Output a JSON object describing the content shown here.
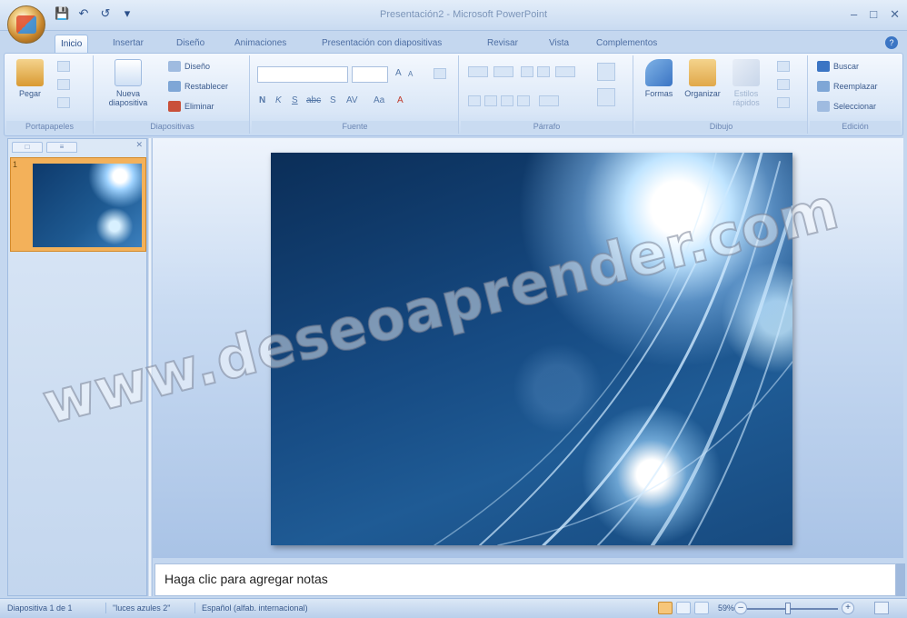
{
  "window": {
    "title": "Presentación2 - Microsoft PowerPoint"
  },
  "tabs": [
    "Inicio",
    "Insertar",
    "Diseño",
    "Animaciones",
    "Presentación con diapositivas",
    "Revisar",
    "Vista",
    "Complementos"
  ],
  "ribbon": {
    "portapapeles": {
      "paste_label": "Pegar",
      "group_label": "Portapapeles"
    },
    "diapositivas": {
      "new_slide_label": "Nueva diapositiva",
      "layout_label": "Diseño",
      "reset_label": "Restablecer",
      "delete_label": "Eliminar",
      "group_label": "Diapositivas"
    },
    "fuente": {
      "group_label": "Fuente",
      "bold": "N",
      "italic": "K",
      "underline": "S",
      "strike": "abc",
      "shadow": "S",
      "spacing": "AV",
      "case": "Aa",
      "color": "A",
      "grow": "A",
      "shrink": "A"
    },
    "parrafo": {
      "group_label": "Párrafo"
    },
    "dibujo": {
      "shapes_label": "Formas",
      "arrange_label": "Organizar",
      "quick_styles_label": "Estilos rápidos",
      "group_label": "Dibujo"
    },
    "edicion": {
      "find_label": "Buscar",
      "replace_label": "Reemplazar",
      "select_label": "Seleccionar",
      "group_label": "Edición"
    }
  },
  "slides_pane": {
    "slide_number": "1"
  },
  "notes": {
    "placeholder": "Haga clic para agregar notas"
  },
  "watermark": "www.deseoaprender.com",
  "status": {
    "slide": "Diapositiva 1 de 1",
    "theme": "\"luces azules 2\"",
    "language": "Español (alfab. internacional)",
    "zoom": "59%",
    "zoom_level": 0.45
  },
  "colors": {
    "slide_dark": "#0b2e58",
    "slide_mid": "#1f5b95",
    "accent": "#f3b15a"
  }
}
